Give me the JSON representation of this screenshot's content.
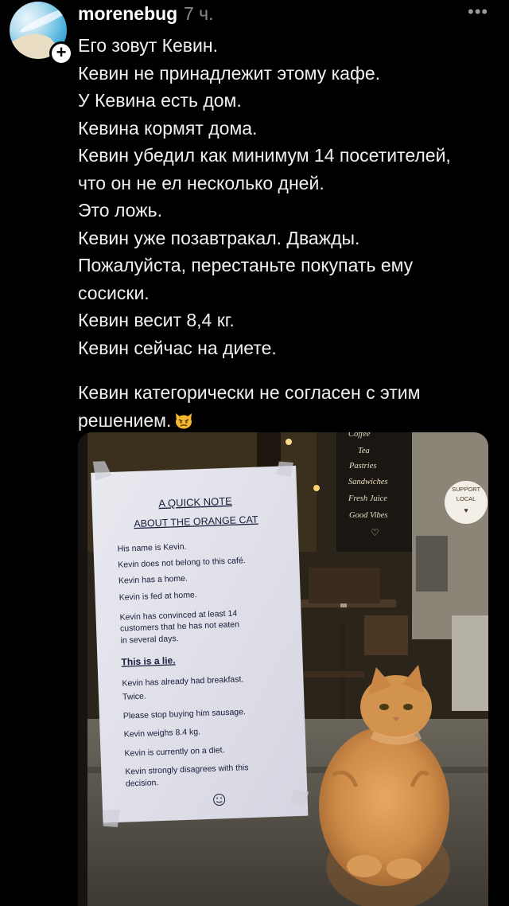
{
  "post": {
    "username": "morenebug",
    "time": "7 ч.",
    "lines": [
      "Его зовут Кевин.",
      "Кевин не принадлежит этому кафе.",
      "У Кевина есть дом.",
      "Кевина кормят дома.",
      "Кевин убедил как минимум 14 посетителей,",
      "что он не ел несколько дней.",
      "Это ложь.",
      "Кевин уже позавтракал. Дважды.",
      "Пожалуйста, перестаньте покупать ему",
      "сосиски.",
      "Кевин весит 8,4 кг.",
      "Кевин сейчас на диете."
    ],
    "closing_lines": [
      "Кевин категорически не согласен с этим",
      "решением."
    ]
  },
  "photo": {
    "note_title_1": "A QUICK NOTE",
    "note_title_2": "ABOUT THE ORANGE CAT",
    "note_lines": [
      "His name is Kevin.",
      "Kevin does not belong to this café.",
      "Kevin has a home.",
      "Kevin is fed at home.",
      "Kevin has convinced at least 14",
      "customers that he has not eaten",
      "in several days.",
      "This is a lie.",
      "Kevin has already had breakfast.",
      "Twice.",
      "Please stop buying him sausage.",
      "Kevin weighs 8.4 kg.",
      "Kevin is currently on a diet.",
      "Kevin strongly disagrees with this",
      "decision."
    ],
    "menu_board": [
      "Coffee",
      "Tea",
      "Pastries",
      "Sandwiches",
      "Fresh Juice",
      "Good Vibes"
    ],
    "sticker_1": "SUPPORT",
    "sticker_2": "LOCAL"
  },
  "icons": {
    "avatar": "avatar",
    "follow": "plus-icon",
    "more": "more-dots-icon",
    "emoji": "pouting-cat-emoji"
  }
}
